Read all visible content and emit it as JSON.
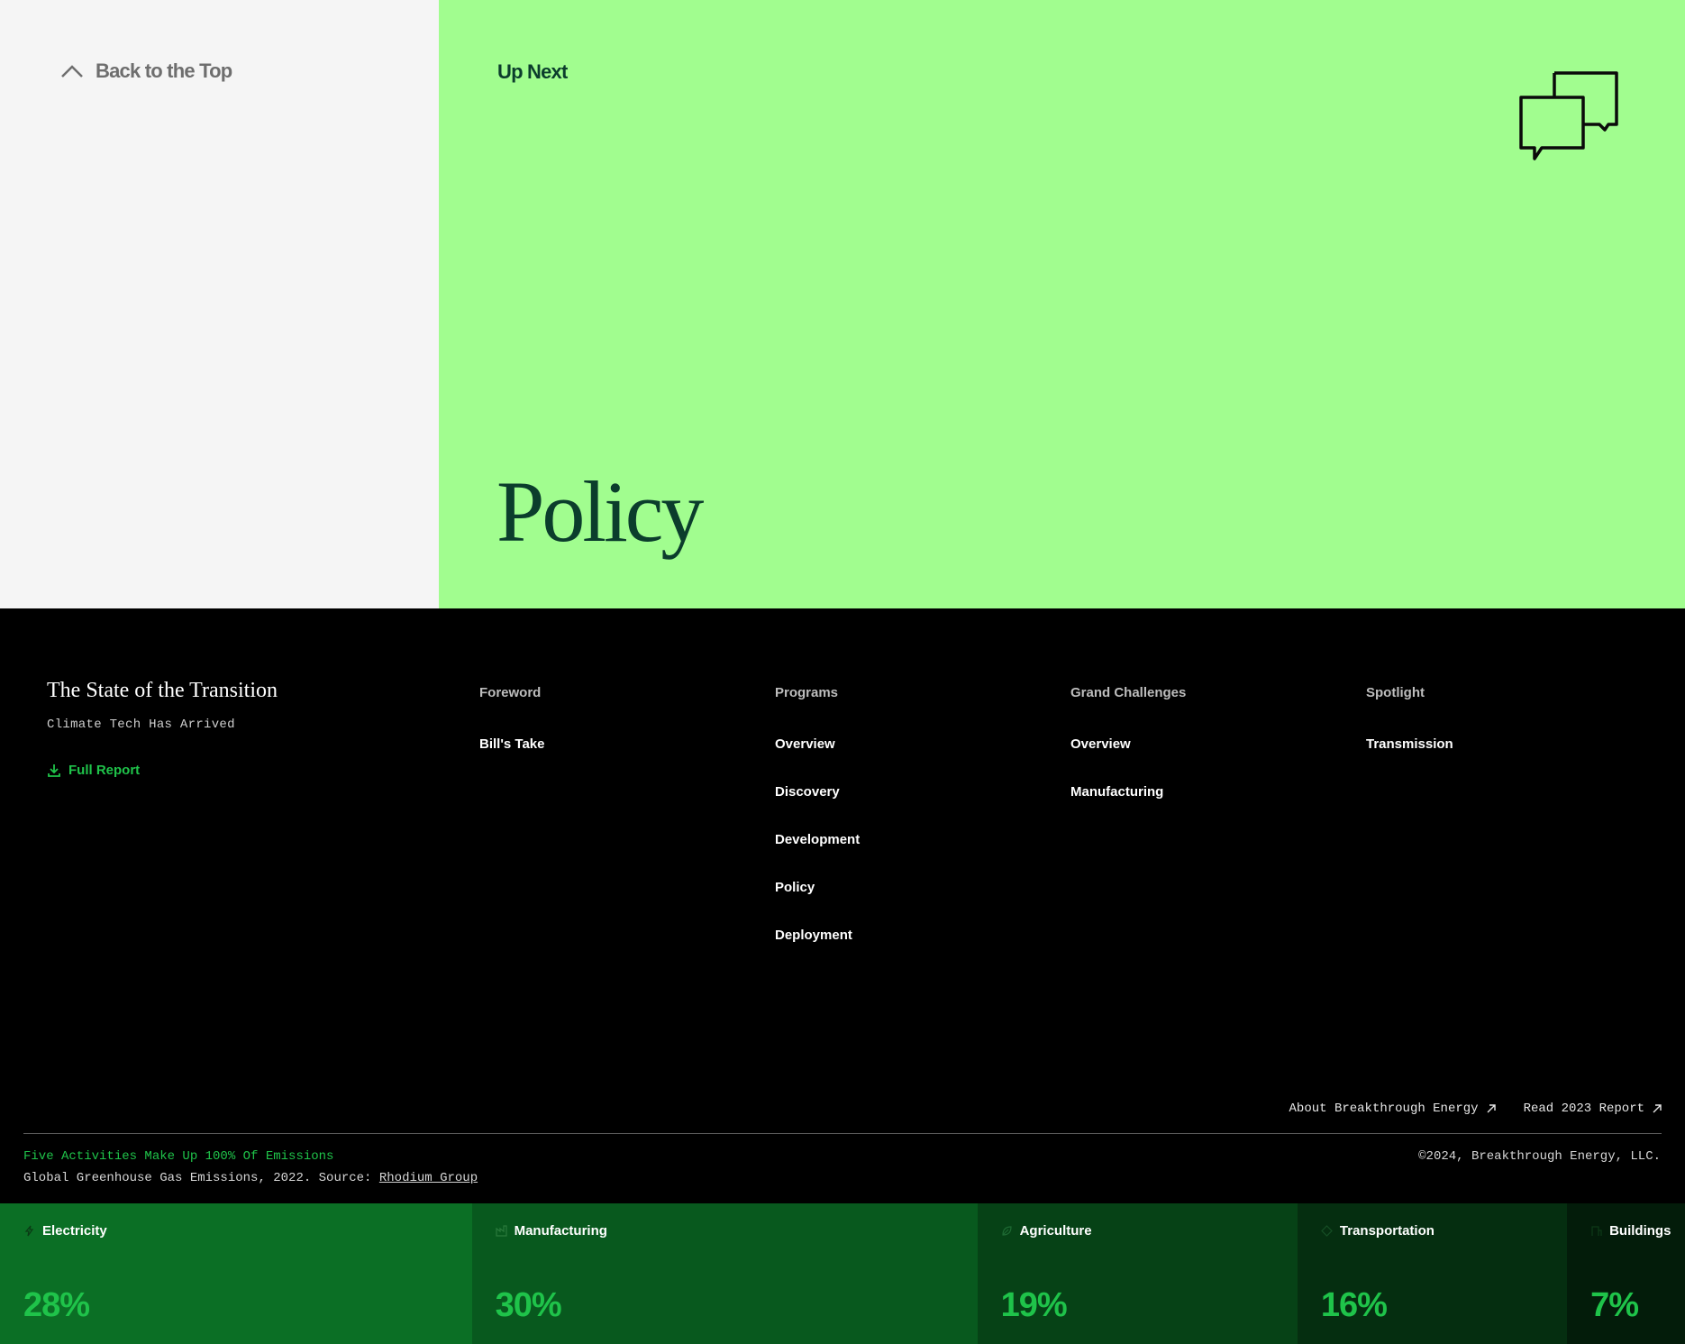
{
  "back_to_top": {
    "label": "Back to the Top"
  },
  "up_next": {
    "label": "Up Next",
    "title": "Policy",
    "icon": "chat-bubbles-icon"
  },
  "footer": {
    "brand_title": "The State of the Transition",
    "brand_subtitle": "Climate Tech Has Arrived",
    "full_report_label": "Full Report",
    "columns": {
      "foreword": {
        "heading": "Foreword",
        "links": [
          "Bill's Take"
        ]
      },
      "programs": {
        "heading": "Programs",
        "links": [
          "Overview",
          "Discovery",
          "Development",
          "Policy",
          "Deployment"
        ]
      },
      "grand_challenges": {
        "heading": "Grand Challenges",
        "links": [
          "Overview",
          "Manufacturing"
        ]
      },
      "spotlight": {
        "heading": "Spotlight",
        "links": [
          "Transmission"
        ]
      }
    },
    "external_links": {
      "about": "About Breakthrough Energy",
      "read_2023": "Read 2023 Report"
    },
    "emissions_title": "Five Activities Make Up 100% Of Emissions",
    "emissions_source_prefix": "Global Greenhouse Gas Emissions, 2022. Source: ",
    "emissions_source_link": "Rhodium Group",
    "copyright": "©2024, Breakthrough Energy, LLC."
  },
  "emissions": [
    {
      "label": "Electricity",
      "value": "28%",
      "share": 28,
      "icon": "lightning-icon",
      "color": "#0b6f25"
    },
    {
      "label": "Manufacturing",
      "value": "30%",
      "share": 30,
      "icon": "factory-icon",
      "color": "#08591e"
    },
    {
      "label": "Agriculture",
      "value": "19%",
      "share": 19,
      "icon": "leaf-icon",
      "color": "#064216"
    },
    {
      "label": "Transportation",
      "value": "16%",
      "share": 16,
      "icon": "diamond-icon",
      "color": "#052e10"
    },
    {
      "label": "Buildings",
      "value": "7%",
      "share": 7,
      "icon": "building-icon",
      "color": "#031c0a"
    }
  ],
  "colors": {
    "accent_green": "#a1fd8f",
    "dark_green_text": "#0b3d2c",
    "bright_green": "#1fc34a",
    "back_panel_bg": "#f5f5f5"
  }
}
